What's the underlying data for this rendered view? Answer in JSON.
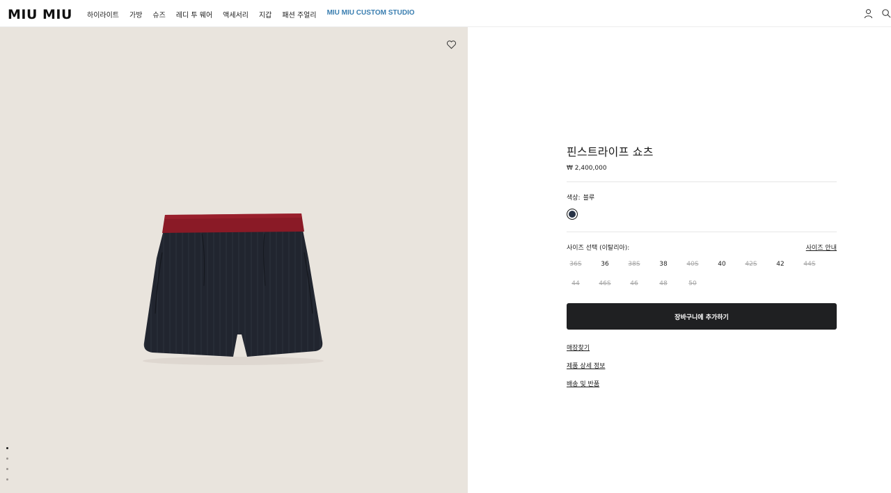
{
  "header": {
    "logo": "MIU MIU",
    "nav": [
      "하이라이트",
      "가방",
      "슈즈",
      "레디 투 웨어",
      "액세서리",
      "지갑",
      "패션 주얼리",
      "MIU MIU CUSTOM STUDIO"
    ],
    "icons": [
      "account-icon",
      "search-icon"
    ]
  },
  "gallery": {
    "wishlist_icon": "heart-icon",
    "slide_count": 4,
    "active_slide": 1
  },
  "product": {
    "title": "핀스트라이프 쇼츠",
    "price": "₩ 2,400,000",
    "color_label": "색상:",
    "color_value": "블루",
    "swatch_color": "#283447",
    "size_label": "사이즈 선택 (이탈리아):",
    "size_guide": "사이즈 안내",
    "sizes_row1": [
      {
        "label": "36S",
        "available": false
      },
      {
        "label": "36",
        "available": true
      },
      {
        "label": "38S",
        "available": false
      },
      {
        "label": "38",
        "available": true
      },
      {
        "label": "40S",
        "available": false
      },
      {
        "label": "40",
        "available": true
      },
      {
        "label": "42S",
        "available": false
      },
      {
        "label": "42",
        "available": true
      },
      {
        "label": "44S",
        "available": false
      }
    ],
    "sizes_row2": [
      {
        "label": "44",
        "available": false
      },
      {
        "label": "46S",
        "available": false
      },
      {
        "label": "46",
        "available": false
      },
      {
        "label": "48",
        "available": false
      },
      {
        "label": "50",
        "available": false
      }
    ],
    "add_to_cart": "장바구니에 추가하기",
    "links": [
      "매장찾기",
      "제품 상세 정보",
      "배송 및 반품"
    ]
  }
}
